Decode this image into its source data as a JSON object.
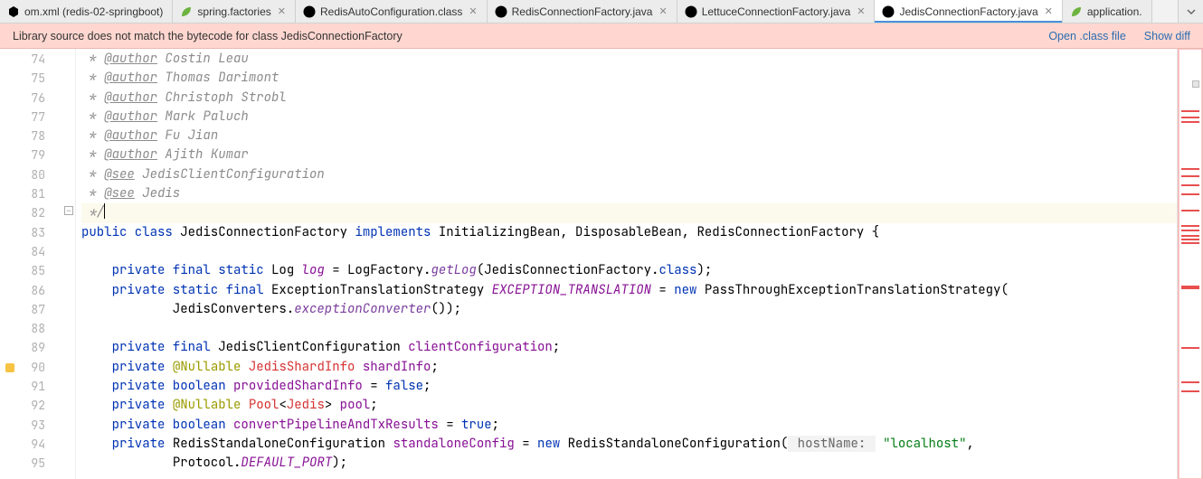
{
  "tabs": [
    {
      "label": "om.xml (redis-02-springboot)",
      "icon": "xml",
      "closeable": false,
      "active": false,
      "truncated_left": true
    },
    {
      "label": "spring.factories",
      "icon": "spring",
      "closeable": true,
      "active": false
    },
    {
      "label": "RedisAutoConfiguration.class",
      "icon": "class",
      "closeable": true,
      "active": false
    },
    {
      "label": "RedisConnectionFactory.java",
      "icon": "interface",
      "closeable": true,
      "active": false
    },
    {
      "label": "LettuceConnectionFactory.java",
      "icon": "class",
      "closeable": true,
      "active": false
    },
    {
      "label": "JedisConnectionFactory.java",
      "icon": "class",
      "closeable": true,
      "active": true
    },
    {
      "label": "application.",
      "icon": "spring",
      "closeable": false,
      "active": false,
      "truncated_right": true
    }
  ],
  "warning": {
    "text": "Library source does not match the bytecode for class JedisConnectionFactory",
    "open_label": "Open .class file",
    "diff_label": "Show diff"
  },
  "gutter": {
    "start": 74,
    "end": 95,
    "warn_lines": [
      90
    ]
  },
  "code": {
    "lines": [
      {
        "n": 74,
        "html": "<span class='c-doc'> * </span><span class='c-tag'>@author</span><span class='c-doc'> Costin Leau</span>"
      },
      {
        "n": 75,
        "html": "<span class='c-doc'> * </span><span class='c-tag'>@author</span><span class='c-doc'> Thomas Darimont</span>"
      },
      {
        "n": 76,
        "html": "<span class='c-doc'> * </span><span class='c-tag'>@author</span><span class='c-doc'> Christoph Strobl</span>"
      },
      {
        "n": 77,
        "html": "<span class='c-doc'> * </span><span class='c-tag'>@author</span><span class='c-doc'> Mark Paluch</span>"
      },
      {
        "n": 78,
        "html": "<span class='c-doc'> * </span><span class='c-tag'>@author</span><span class='c-doc'> Fu Jian</span>"
      },
      {
        "n": 79,
        "html": "<span class='c-doc'> * </span><span class='c-tag'>@author</span><span class='c-doc'> Ajith Kumar</span>"
      },
      {
        "n": 80,
        "html": "<span class='c-doc'> * </span><span class='c-tag'>@see</span><span class='c-doc'> JedisClientConfiguration</span>"
      },
      {
        "n": 81,
        "html": "<span class='c-doc'> * </span><span class='c-tag'>@see</span><span class='c-doc'> Jedis</span>"
      },
      {
        "n": 82,
        "html": "<span class='c-doc'> */</span>",
        "caret_after": true,
        "caret_row": true
      },
      {
        "n": 83,
        "html": "<span class='c-kw'>public class </span><span class='c-type'>JedisConnectionFactory</span> <span class='c-kw'>implements</span> <span class='c-type'>InitializingBean</span>, <span class='c-type'>DisposableBean</span>, <span class='c-type'>RedisConnectionFactory</span> {"
      },
      {
        "n": 84,
        "html": ""
      },
      {
        "n": 85,
        "html": "    <span class='c-kw'>private final static</span> <span class='c-type'>Log</span> <span class='c-static'>log</span> = <span class='c-type'>LogFactory</span>.<span class='c-mname'>getLog</span>(JedisConnectionFactory.<span class='c-kw'>class</span>);"
      },
      {
        "n": 86,
        "html": "    <span class='c-kw'>private static final</span> <span class='c-type'>ExceptionTranslationStrategy</span> <span class='c-static'>EXCEPTION_TRANSLATION</span> = <span class='c-kw'>new</span> <span class='c-type'>PassThroughExceptionTranslationStrategy</span>("
      },
      {
        "n": 87,
        "html": "            JedisConverters.<span class='c-mname'>exceptionConverter</span>());"
      },
      {
        "n": 88,
        "html": ""
      },
      {
        "n": 89,
        "html": "    <span class='c-kw'>private final</span> <span class='c-type'>JedisClientConfiguration</span> <span class='c-field'>clientConfiguration</span>;"
      },
      {
        "n": 90,
        "html": "    <span class='c-kw'>private</span> <span class='c-anno'>@Nullable</span> <span class='c-err'>JedisShardInfo</span> <span class='c-field'>shardInfo</span>;"
      },
      {
        "n": 91,
        "html": "    <span class='c-kw'>private boolean</span> <span class='c-field'>providedShardInfo</span> = <span class='c-kw'>false</span>;"
      },
      {
        "n": 92,
        "html": "    <span class='c-kw'>private</span> <span class='c-anno'>@Nullable</span> <span class='c-err'>Pool</span>&lt;<span class='c-err'>Jedis</span>&gt; <span class='c-field'>pool</span>;"
      },
      {
        "n": 93,
        "html": "    <span class='c-kw'>private boolean</span> <span class='c-field'>convertPipelineAndTxResults</span> = <span class='c-kw'>true</span>;"
      },
      {
        "n": 94,
        "html": "    <span class='c-kw'>private</span> <span class='c-type'>RedisStandaloneConfiguration</span> <span class='c-field'>standaloneConfig</span> = <span class='c-kw'>new</span> <span class='c-type'>RedisStandaloneConfiguration</span>(<span class='c-param'> hostName: </span> <span class='c-str'>\"localhost\"</span>,"
      },
      {
        "n": 95,
        "html": "            <span class='c-type'>Protocol</span>.<span class='c-static'>DEFAULT_PORT</span>);"
      }
    ]
  },
  "overview_marks": {
    "boxes": [
      35
    ],
    "bars": [
      68,
      75,
      80,
      132,
      140,
      150,
      160,
      178,
      195,
      200,
      206,
      210,
      214,
      262,
      264,
      330,
      368,
      378
    ]
  }
}
